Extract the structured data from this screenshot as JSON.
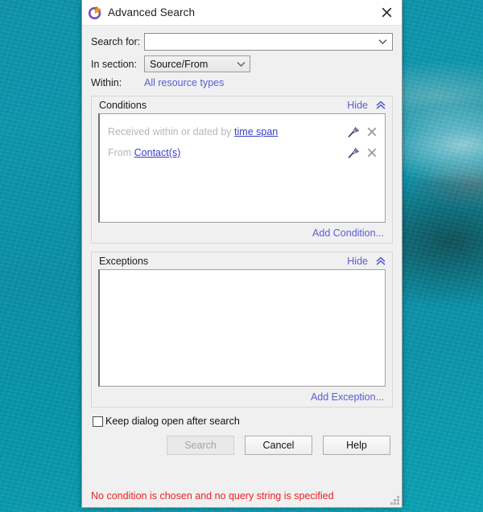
{
  "window": {
    "title": "Advanced Search",
    "icon": "advanced-search-icon",
    "close_label": "×"
  },
  "form": {
    "search_for": {
      "label": "Search for:",
      "value": "",
      "placeholder": "",
      "chevron": "chevron-down-icon"
    },
    "in_section": {
      "label": "In section:",
      "value": "Source/From",
      "options": [
        "Source/From"
      ],
      "chevron": "chevron-down-icon"
    },
    "within": {
      "label": "Within:",
      "value": "All resource types"
    }
  },
  "conditions": {
    "title": "Conditions",
    "hide_label": "Hide",
    "collapse_icon": "double-chevron-up-icon",
    "rows": [
      {
        "prefix": "Received within or dated by ",
        "link": "time span",
        "suffix": "",
        "edit_icon": "pin-edit-icon",
        "remove_icon": "close-x-icon"
      },
      {
        "prefix": "From ",
        "link": "Contact(s)",
        "suffix": "",
        "edit_icon": "pin-edit-icon",
        "remove_icon": "close-x-icon"
      }
    ],
    "add_label": "Add Condition..."
  },
  "exceptions": {
    "title": "Exceptions",
    "hide_label": "Hide",
    "collapse_icon": "double-chevron-up-icon",
    "rows": [],
    "add_label": "Add Exception..."
  },
  "options": {
    "keep_open_label": "Keep dialog open after search",
    "keep_open_checked": false
  },
  "buttons": {
    "search": "Search",
    "search_disabled": true,
    "cancel": "Cancel",
    "help": "Help"
  },
  "status": {
    "message": "No condition is chosen and no query string is specified",
    "color": "#ee2222"
  },
  "colors": {
    "link": "#5b5bd6",
    "error": "#ee2222",
    "dialog_bg": "#f0f0f0",
    "desktop": "#0a92a8"
  }
}
